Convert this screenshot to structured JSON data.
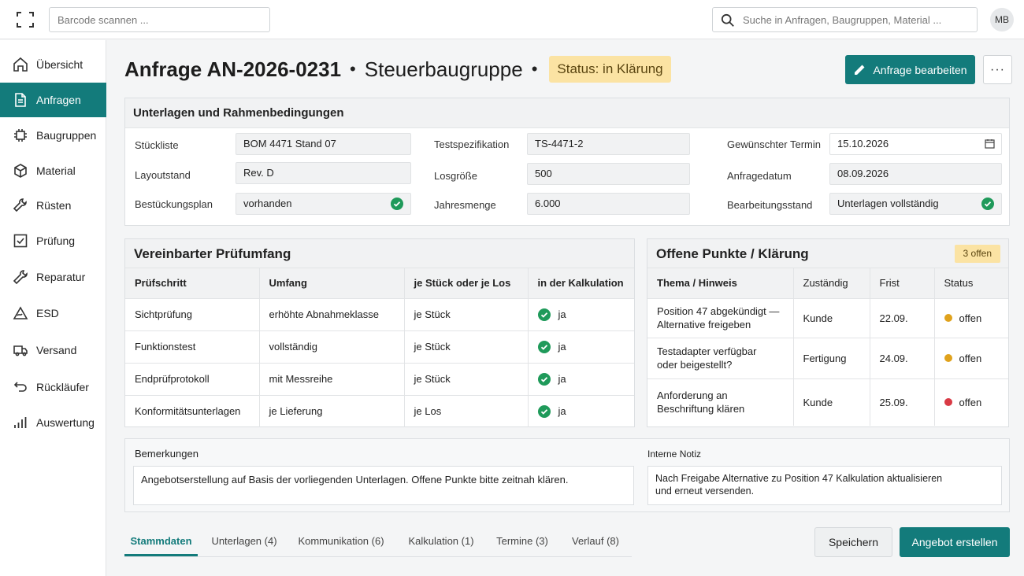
{
  "topbar": {
    "barcode_placeholder": "Barcode scannen ...",
    "search_placeholder": "Suche in Anfragen, Baugruppen, Material ...",
    "avatar_initials": "MB"
  },
  "sidebar": {
    "items": [
      {
        "label": "Übersicht",
        "icon": "home-icon"
      },
      {
        "label": "Anfragen",
        "icon": "document-icon",
        "active": true
      },
      {
        "label": "Baugruppen",
        "icon": "chip-icon"
      },
      {
        "label": "Material",
        "icon": "cube-icon"
      },
      {
        "label": "Rüsten",
        "icon": "wrench-icon"
      },
      {
        "label": "Prüfung",
        "icon": "checkbox-icon"
      },
      {
        "label": "Reparatur",
        "icon": "repair-icon"
      },
      {
        "label": "ESD",
        "icon": "esd-icon"
      },
      {
        "label": "Versand",
        "icon": "truck-icon"
      },
      {
        "label": "Rückläufer",
        "icon": "return-icon"
      },
      {
        "label": "Auswertung",
        "icon": "chart-icon"
      }
    ]
  },
  "header": {
    "title": "Anfrage AN-2026-0231",
    "separator": "•",
    "subtitle": "Steuerbaugruppe",
    "status": "Status: in Klärung",
    "edit_button": "Anfrage bearbeiten",
    "more_button": "···"
  },
  "unterlagen": {
    "title": "Unterlagen und Rahmenbedingungen",
    "fields": {
      "stueckliste": {
        "label": "Stückliste",
        "value": "BOM 4471 Stand 07"
      },
      "layoutstand": {
        "label": "Layoutstand",
        "value": "Rev. D"
      },
      "bestueckungsplan": {
        "label": "Bestückungsplan",
        "value": "vorhanden"
      },
      "testspezifikation": {
        "label": "Testspezifikation",
        "value": "TS-4471-2"
      },
      "losgroesse": {
        "label": "Losgröße",
        "value": "500"
      },
      "jahresmenge": {
        "label": "Jahresmenge",
        "value": "6.000"
      },
      "termin": {
        "label": "Gewünschter Termin",
        "value": "15.10.2026"
      },
      "anfragedatum": {
        "label": "Anfragedatum",
        "value": "08.09.2026"
      },
      "bearbeitungsstand": {
        "label": "Bearbeitungsstand",
        "value": "Unterlagen vollständig"
      }
    }
  },
  "pruefumfang": {
    "title": "Vereinbarter Prüfumfang",
    "headers": [
      "Prüfschritt",
      "Umfang",
      "je Stück oder je Los",
      "in der Kalkulation"
    ],
    "rows": [
      {
        "schritt": "Sichtprüfung",
        "umfang": "erhöhte Abnahmeklasse",
        "basis": "je Stück",
        "kalkulation": "ja"
      },
      {
        "schritt": "Funktionstest",
        "umfang": "vollständig",
        "basis": "je Stück",
        "kalkulation": "ja"
      },
      {
        "schritt": "Endprüfprotokoll",
        "umfang": "mit Messreihe",
        "basis": "je Stück",
        "kalkulation": "ja"
      },
      {
        "schritt": "Konformitätsunterlagen",
        "umfang": "je Lieferung",
        "basis": "je Los",
        "kalkulation": "ja"
      }
    ]
  },
  "offene_punkte": {
    "title": "Offene Punkte / Klärung",
    "badge": "3 offen",
    "headers": [
      "Thema / Hinweis",
      "Zuständig",
      "Frist",
      "Status"
    ],
    "rows": [
      {
        "thema_1": "Position 47 abgekündigt —",
        "thema_2": "Alternative freigeben",
        "zustaendig": "Kunde",
        "frist": "22.09.",
        "status": "offen",
        "status_color": "#e0a21c"
      },
      {
        "thema_1": "Testadapter verfügbar",
        "thema_2": "oder beigestellt?",
        "zustaendig": "Fertigung",
        "frist": "24.09.",
        "status": "offen",
        "status_color": "#e0a21c"
      },
      {
        "thema_1": "Anforderung an",
        "thema_2": "Beschriftung klären",
        "zustaendig": "Kunde",
        "frist": "25.09.",
        "status": "offen",
        "status_color": "#d93a45"
      }
    ]
  },
  "notes": {
    "bemerkungen_label": "Bemerkungen",
    "bemerkungen_text": "Angebotserstellung auf Basis der vorliegenden Unterlagen. Offene Punkte bitte zeitnah klären.",
    "intern_label": "Interne Notiz",
    "intern_line1": "Nach Freigabe Alternative zu Position 47 Kalkulation aktualisieren",
    "intern_line2": "und erneut versenden."
  },
  "tabs": [
    {
      "label": "Stammdaten",
      "active": true
    },
    {
      "label": "Unterlagen (4)"
    },
    {
      "label": "Kommunikation (6)"
    },
    {
      "label": "Kalkulation (1)"
    },
    {
      "label": "Termine (3)"
    },
    {
      "label": "Verlauf (8)"
    }
  ],
  "actions": {
    "save": "Speichern",
    "create_offer": "Angebot erstellen"
  },
  "colors": {
    "accent": "#137b7b",
    "status_bg": "#fbe3a3",
    "success": "#1f9a5a",
    "warning": "#e0a21c",
    "danger": "#d93a45"
  }
}
